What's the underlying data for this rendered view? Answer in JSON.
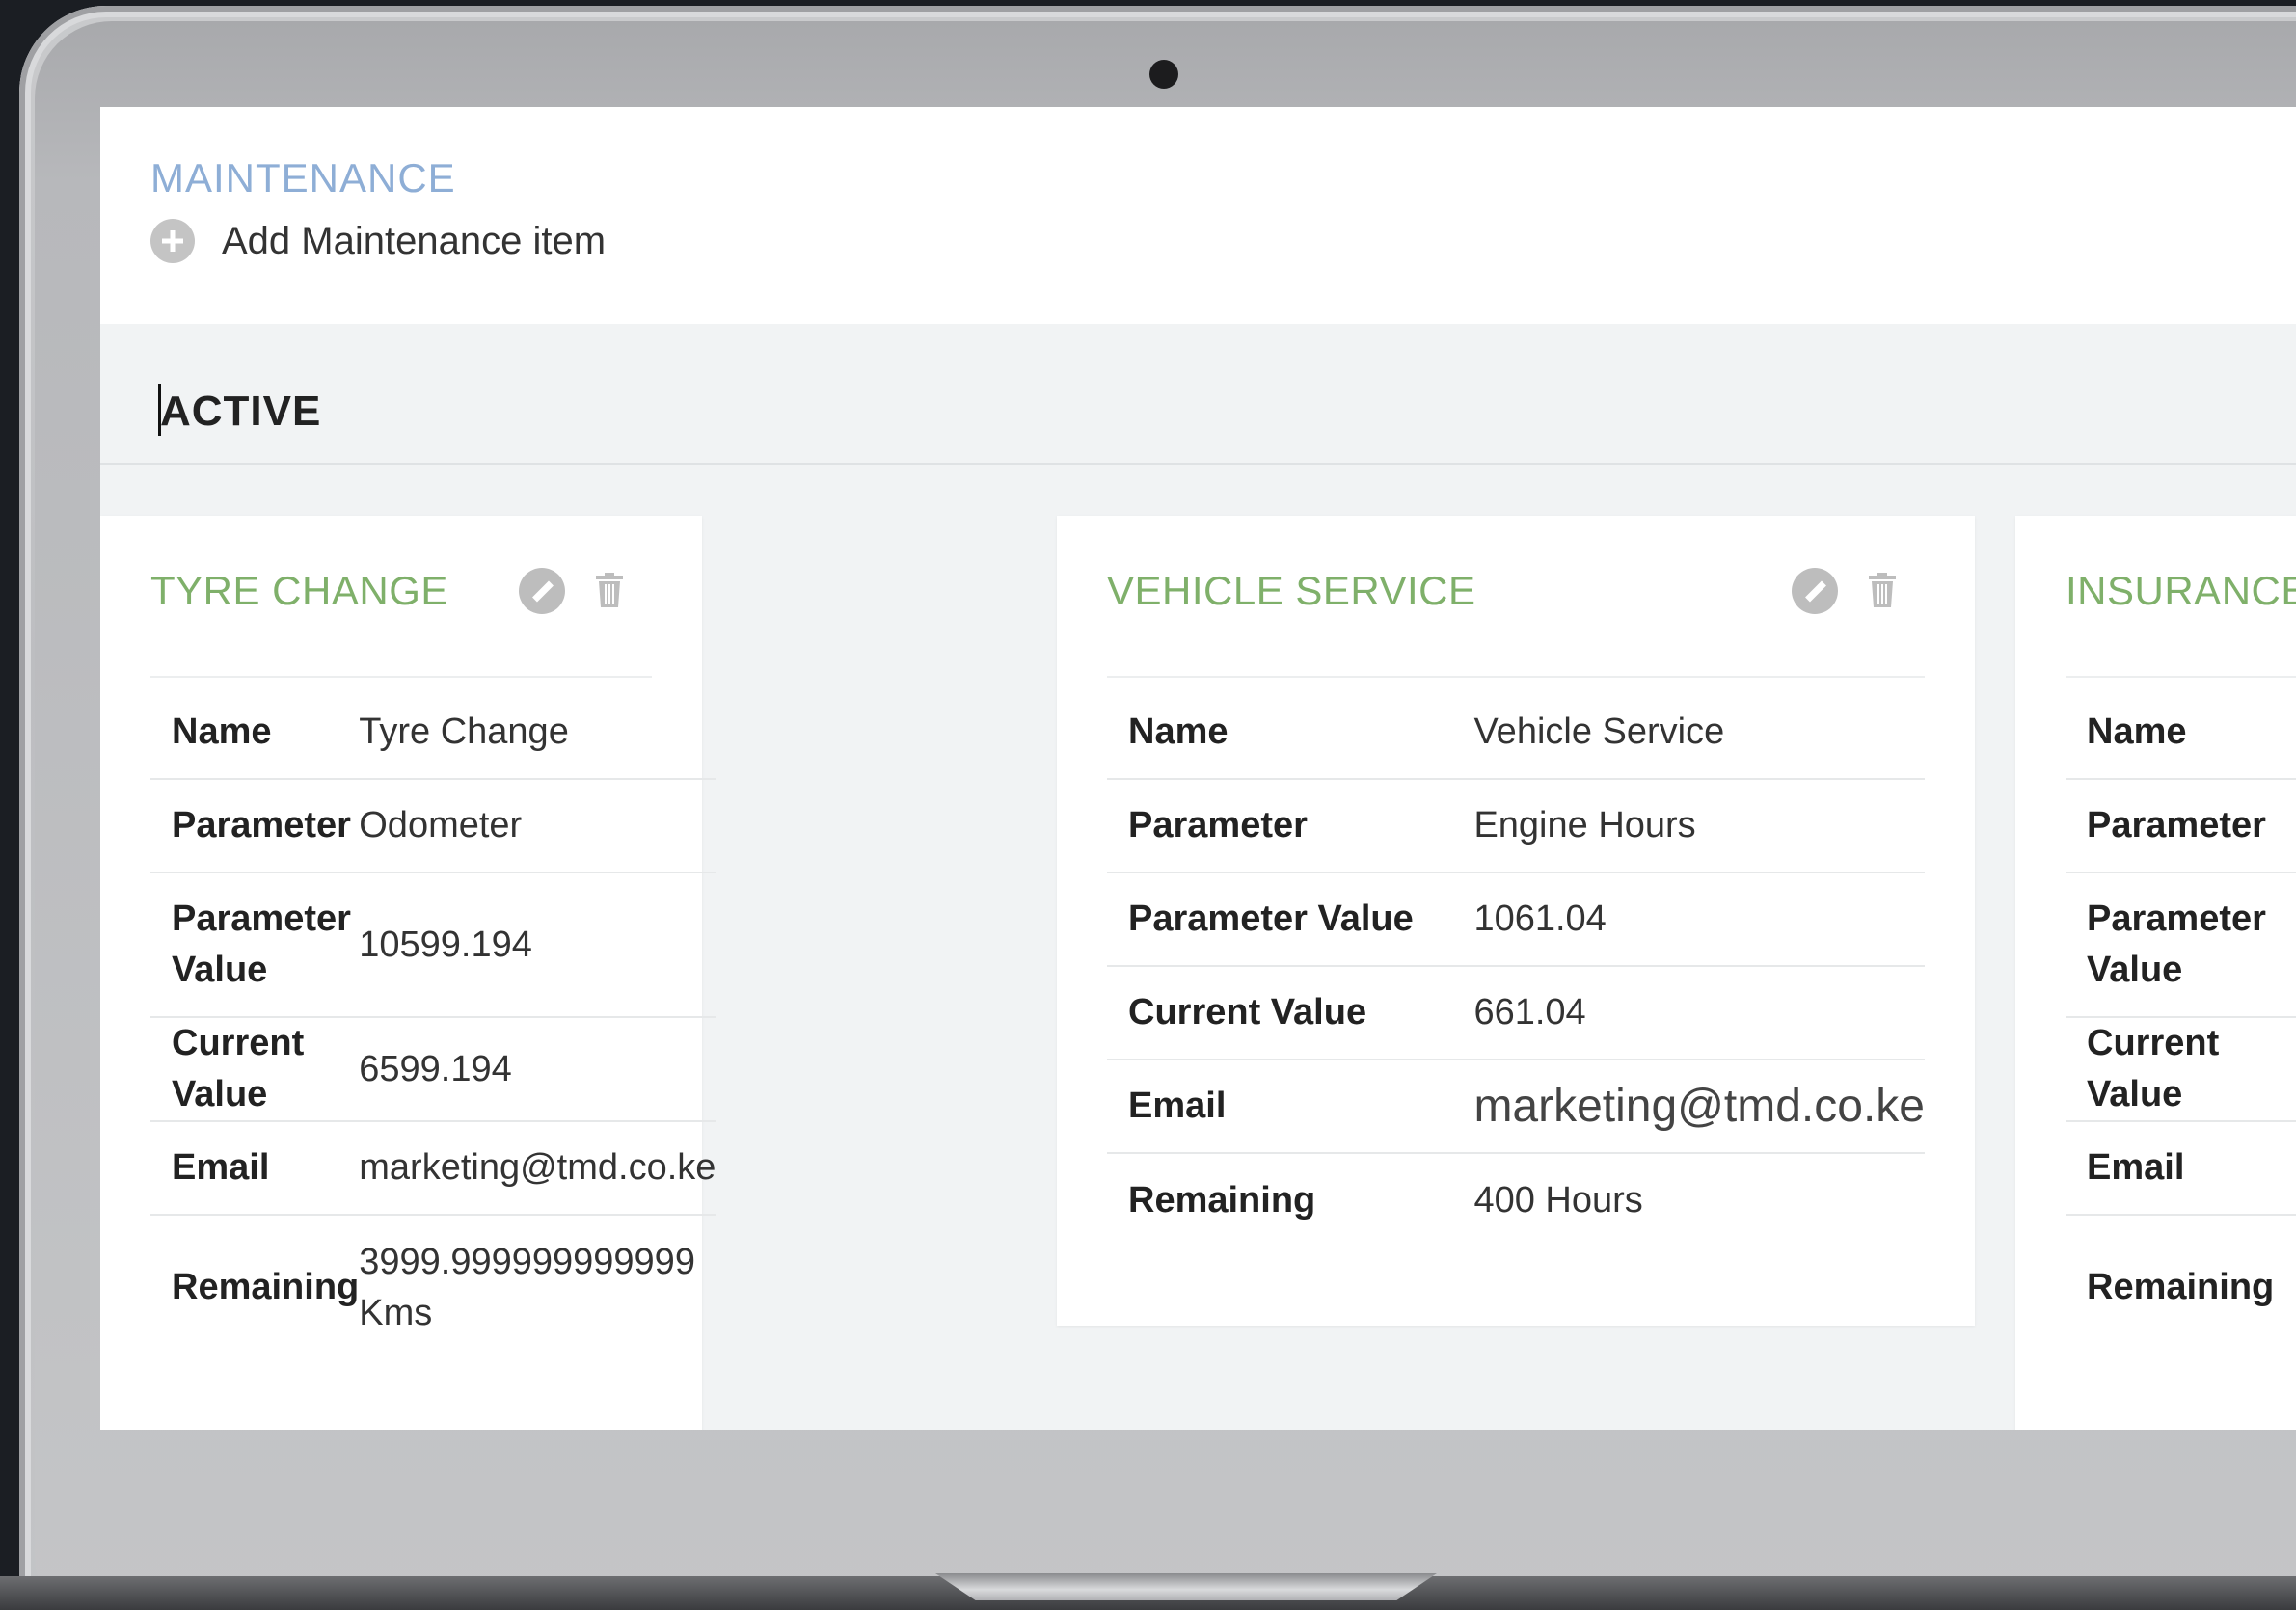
{
  "header": {
    "section_title": "MAINTENANCE",
    "add_label": "Add Maintenance item"
  },
  "status": {
    "label": "ACTIVE"
  },
  "cards": [
    {
      "title": "TYRE CHANGE",
      "rows": [
        {
          "key": "Name",
          "value": "Tyre Change"
        },
        {
          "key": "Parameter",
          "value": "Odometer"
        },
        {
          "key": "Parameter Value",
          "value": "10599.194"
        },
        {
          "key": "Current Value",
          "value": "6599.194"
        },
        {
          "key": "Email",
          "value": "marketing@tmd.co.ke"
        },
        {
          "key": "Remaining",
          "value": "3999.999999999999 Kms"
        }
      ]
    },
    {
      "title": "VEHICLE SERVICE",
      "rows": [
        {
          "key": "Name",
          "value": "Vehicle Service"
        },
        {
          "key": "Parameter",
          "value": "Engine Hours"
        },
        {
          "key": "Parameter Value",
          "value": "1061.04"
        },
        {
          "key": "Current Value",
          "value": "661.04"
        },
        {
          "key": "Email",
          "value": "marketing@tmd.co.ke"
        },
        {
          "key": "Remaining",
          "value": "400 Hours"
        }
      ]
    },
    {
      "title": "INSURANCE",
      "rows": [
        {
          "key": "Name",
          "value": ""
        },
        {
          "key": "Parameter",
          "value": ""
        },
        {
          "key": "Parameter Value",
          "value": ""
        },
        {
          "key": "Current Value",
          "value": ""
        },
        {
          "key": "Email",
          "value": ""
        },
        {
          "key": "Remaining",
          "value": ""
        }
      ]
    }
  ],
  "colors": {
    "section_title": "#8eaed6",
    "card_title": "#7fb06a",
    "screen_bg": "#f1f3f4"
  },
  "icons": {
    "add": "plus-circle-icon",
    "edit": "pencil-circle-icon",
    "delete": "trash-icon",
    "camera": "camera-dot"
  }
}
